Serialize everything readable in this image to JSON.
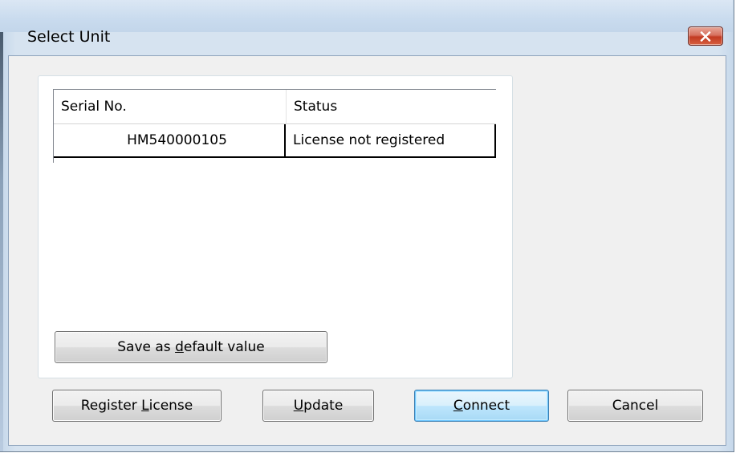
{
  "window": {
    "title": "Select Unit"
  },
  "table": {
    "columns": [
      "Serial No.",
      "Status"
    ],
    "rows": [
      {
        "serial": "HM540000105",
        "status": "License not registered"
      }
    ]
  },
  "buttons": {
    "save_default": {
      "pre": "Save as ",
      "mnemonic": "d",
      "post": "efault value"
    },
    "register": {
      "pre": "Register ",
      "mnemonic": "L",
      "post": "icense"
    },
    "update": {
      "pre": "",
      "mnemonic": "U",
      "post": "pdate"
    },
    "connect": {
      "pre": "",
      "mnemonic": "C",
      "post": "onnect"
    },
    "cancel": {
      "label": "Cancel"
    }
  },
  "icons": {
    "close": "close-icon"
  },
  "colors": {
    "close_button": "#c94a31",
    "window_frame": "#c9dbee",
    "default_button_border": "#3c7fb1"
  }
}
